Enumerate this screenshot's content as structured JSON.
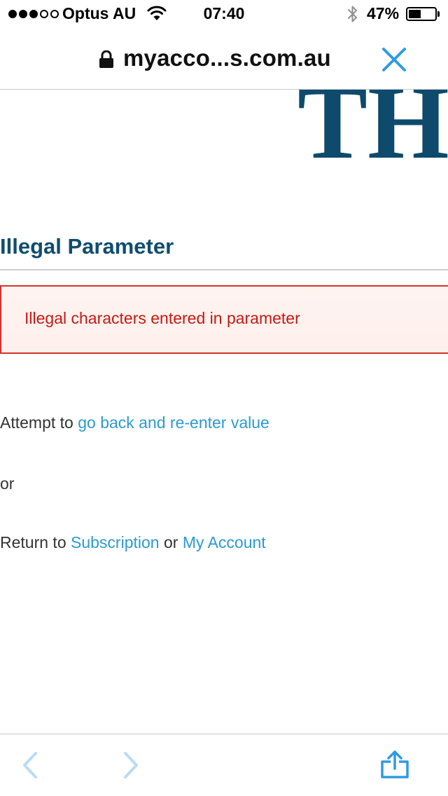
{
  "status_bar": {
    "carrier": "Optus AU",
    "time": "07:40",
    "battery_percent": "47%",
    "battery_level": 0.47,
    "signal_bars_filled": 3,
    "signal_bars_total": 5
  },
  "browser": {
    "url": "myacco...s.com.au"
  },
  "page": {
    "logo_text": "TH",
    "title": "Illegal Parameter",
    "error_message": "Illegal characters entered in parameter",
    "line1_prefix": "Attempt to ",
    "go_back_link": "go back and re-enter value",
    "or_text": "or",
    "line3_prefix": "Return to ",
    "subscription_link": "Subscription",
    "line3_middle": " or ",
    "my_account_link": "My Account"
  },
  "colors": {
    "link": "#2b9bd0",
    "title": "#0f4d6e",
    "error_text": "#c81812",
    "error_border": "#d6332e",
    "ios_blue": "#2f9be0"
  },
  "icons": {
    "wifi": "wifi-icon",
    "bluetooth": "bluetooth-icon",
    "lock": "lock-icon",
    "close": "close-icon",
    "back": "chevron-left-icon",
    "forward": "chevron-right-icon",
    "share": "share-icon"
  }
}
